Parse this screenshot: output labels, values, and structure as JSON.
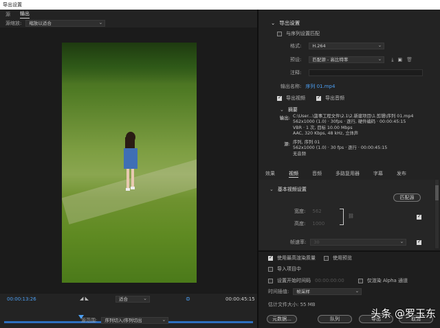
{
  "window": {
    "title": "导出设置"
  },
  "left": {
    "tabs": [
      "源",
      "输出"
    ],
    "active_tab": "输出",
    "scale_label": "源缩放:",
    "scale_value": "缩放以适合",
    "timeline": {
      "current_time": "00:00:13:26",
      "zoom": "适合",
      "end_time": "00:00:45:15",
      "source_range_label": "源范围:",
      "source_range_value": "序列切入/序列切出"
    }
  },
  "right": {
    "export_settings_title": "导出设置",
    "match_sequence": "与序列设置匹配",
    "format_label": "格式:",
    "format_value": "H.264",
    "preset_label": "预设:",
    "preset_value": "匹配源 - 高比特率",
    "comment_label": "注释:",
    "output_name_label": "输出名称:",
    "output_name_value": "序列 01.mp4",
    "export_video": "导出视频",
    "export_audio": "导出音频",
    "summary_title": "摘要",
    "output_label": "输出:",
    "output_lines": [
      "C:\\User...\\菠事工程文件\\2.1\\2.新建项目\\1.剪辑\\序列 01.mp4",
      "562x1000 (1.0) · 30fps · 逐行, 硬件编码 · 00:00:45:15",
      "VBR · 1 次, 目标 10.00 Mbps",
      "AAC, 320 Kbps, 48 kHz, 立体声"
    ],
    "source_label": "源:",
    "source_lines": [
      "序列, 序列 01",
      "562x1000 (1.0) · 30 fps · 逐行 · 00:00:45:15",
      "无音频"
    ],
    "subtabs": [
      "效果",
      "视频",
      "音频",
      "多路复用器",
      "字幕",
      "发布"
    ],
    "active_subtab": "视频",
    "basic_video_title": "基本视频设置",
    "match_source_button": "匹配源",
    "width_label": "宽度:",
    "width_value": "562",
    "height_label": "高度:",
    "height_value": "1000",
    "frame_rate_label": "帧速率:",
    "frame_rate_value": "30",
    "use_max_render": "使用最高渲染质量",
    "use_preview": "使用预览",
    "import_project": "导入项目中",
    "set_start_timecode": "设置开始时间码",
    "timecode_value": "00:00:00:00",
    "render_alpha": "仅渲染 Alpha 通道",
    "time_interp_label": "时间插值:",
    "time_interp_value": "帧采样",
    "file_size": "估计文件大小: 55 MB",
    "metadata_button": "元数据...",
    "queue_button": "队列",
    "export_button": "导出",
    "cancel_button": "取消"
  },
  "watermark": "头条 @罗玉东"
}
